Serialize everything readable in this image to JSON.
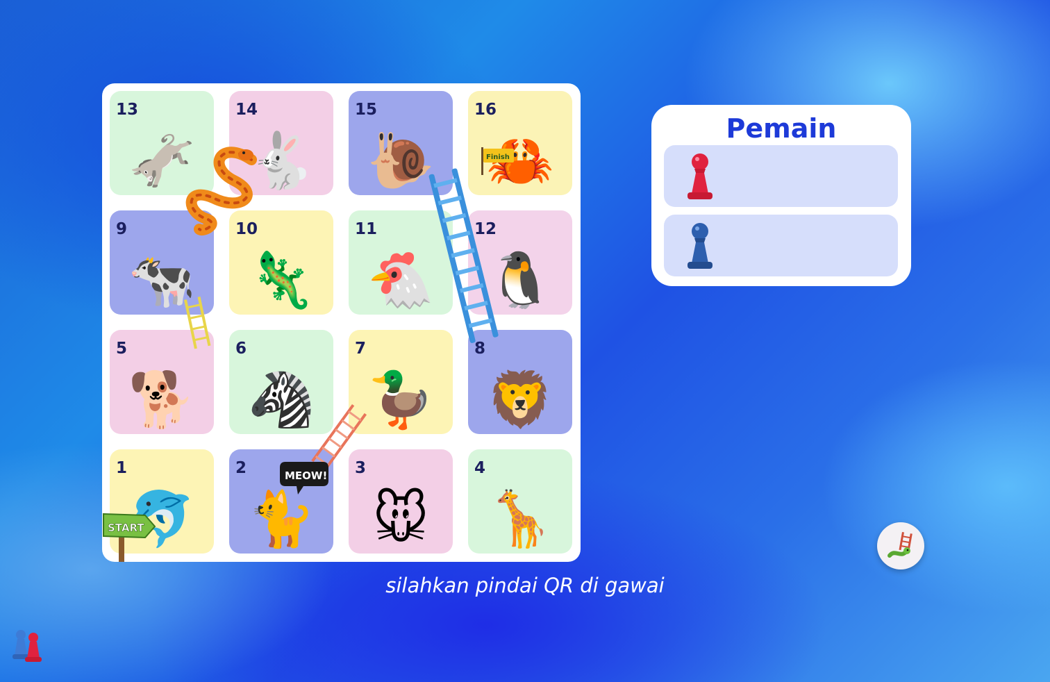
{
  "board": {
    "tiles": [
      {
        "number": "13",
        "animal": "donkey",
        "emoji": "🫏",
        "bg": "#d8f6dc"
      },
      {
        "number": "14",
        "animal": "rabbit",
        "emoji": "🐇",
        "bg": "#f3cfe6"
      },
      {
        "number": "15",
        "animal": "snail",
        "emoji": "🐌",
        "bg": "#9da6ec"
      },
      {
        "number": "16",
        "animal": "crab",
        "emoji": "🦀",
        "bg": "#fbf3b6"
      },
      {
        "number": "9",
        "animal": "cow",
        "emoji": "🐄",
        "bg": "#9da6ec"
      },
      {
        "number": "10",
        "animal": "chameleon",
        "emoji": "🦎",
        "bg": "#fdf4b5"
      },
      {
        "number": "11",
        "animal": "hen",
        "emoji": "🐔",
        "bg": "#d8f6dc"
      },
      {
        "number": "12",
        "animal": "penguin",
        "emoji": "🐧",
        "bg": "#f3d3ea"
      },
      {
        "number": "5",
        "animal": "dog",
        "emoji": "🐕",
        "bg": "#f3cfe6"
      },
      {
        "number": "6",
        "animal": "zebra",
        "emoji": "🦓",
        "bg": "#d8f6dc"
      },
      {
        "number": "7",
        "animal": "duck",
        "emoji": "🦆",
        "bg": "#fdf4b5"
      },
      {
        "number": "8",
        "animal": "lion",
        "emoji": "🦁",
        "bg": "#9da6ec"
      },
      {
        "number": "1",
        "animal": "dolphin",
        "emoji": "🐬",
        "bg": "#fdf4b5"
      },
      {
        "number": "2",
        "animal": "cat",
        "emoji": "🐈",
        "bg": "#9da6ec"
      },
      {
        "number": "3",
        "animal": "mouse",
        "emoji": "🐭",
        "bg": "#f3cfe6"
      },
      {
        "number": "4",
        "animal": "giraffe",
        "emoji": "🦒",
        "bg": "#d8f6dc"
      }
    ],
    "start_sign": "START",
    "finish_flag": "Finish",
    "speech_bubble": "MEOW!"
  },
  "players": {
    "title": "Pemain",
    "list": [
      {
        "pawn": "red-pawn-icon",
        "color": "#e0223f"
      },
      {
        "pawn": "blue-pawn-icon",
        "color": "#2e5fae"
      }
    ]
  },
  "status": {
    "message": "silahkan pindai QR di gawai"
  },
  "colors": {
    "accent": "#1d3ad8",
    "player_slot": "#d6defb"
  }
}
